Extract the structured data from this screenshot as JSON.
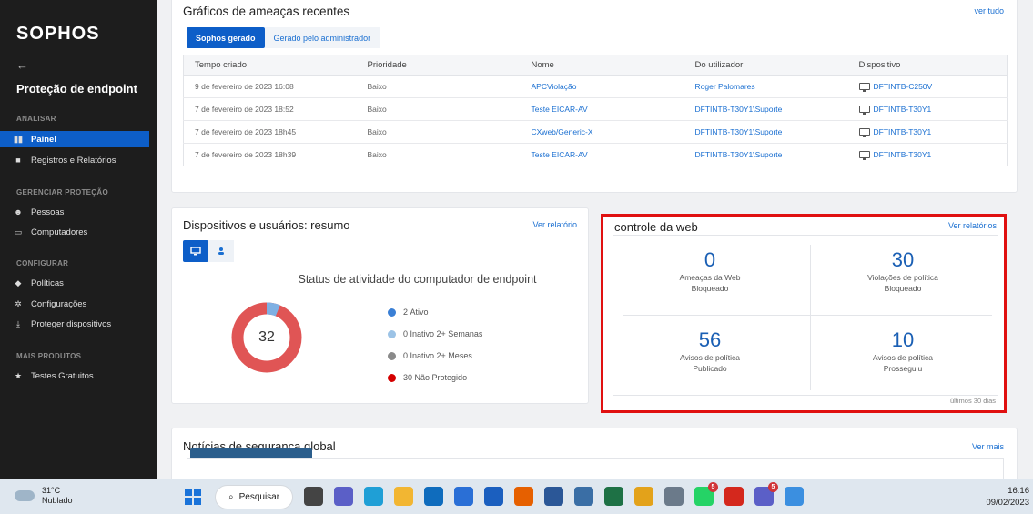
{
  "sidebar": {
    "logo": "SOPHOS",
    "back_arrow": "←",
    "section_title": "Proteção de endpoint",
    "groups": {
      "analisar": "ANALISAR",
      "gerenciar": "GERENCIAR PROTEÇÃO",
      "configurar": "CONFIGURAR",
      "mais": "MAIS PRODUTOS"
    },
    "items": [
      {
        "label": "Painel",
        "icon": "bar-chart-icon",
        "active": true
      },
      {
        "label": "Registros e Relatórios",
        "icon": "document-icon"
      },
      {
        "label": "Pessoas",
        "icon": "people-icon"
      },
      {
        "label": "Computadores",
        "icon": "monitor-icon"
      },
      {
        "label": "Políticas",
        "icon": "shield-icon"
      },
      {
        "label": "Configurações",
        "icon": "gear-icon"
      },
      {
        "label": "Proteger dispositivos",
        "icon": "download-icon"
      },
      {
        "label": "Testes Gratuitos",
        "icon": "star-icon"
      }
    ]
  },
  "threats": {
    "title": "Gráficos de ameaças recentes",
    "link": "ver tudo",
    "tabs": [
      "Sophos gerado",
      "Gerado pelo administrador"
    ],
    "columns": [
      "Tempo criado",
      "Prioridade",
      "Nome",
      "Do utilizador",
      "Dispositivo"
    ],
    "rows": [
      [
        "9 de fevereiro de 2023 16:08",
        "Baixo",
        "APCViolação",
        "Roger Palomares",
        "DFTINTB-C250V"
      ],
      [
        "7 de fevereiro de 2023 18:52",
        "Baixo",
        "Teste EICAR-AV",
        "DFTINTB-T30Y1\\Suporte",
        "DFTINTB-T30Y1"
      ],
      [
        "7 de fevereiro de 2023 18h45",
        "Baixo",
        "CXweb/Generic-X",
        "DFTINTB-T30Y1\\Suporte",
        "DFTINTB-T30Y1"
      ],
      [
        "7 de fevereiro de 2023 18h39",
        "Baixo",
        "Teste EICAR-AV",
        "DFTINTB-T30Y1\\Suporte",
        "DFTINTB-T30Y1"
      ]
    ]
  },
  "devices": {
    "title": "Dispositivos e usuários: resumo",
    "link": "Ver relatório",
    "status_title": "Status de atividade do computador de endpoint",
    "total": "32",
    "legend": [
      {
        "count": "2",
        "label": "Ativo",
        "color": "#3a7fd5"
      },
      {
        "count": "0",
        "label": "Inativo 2+ Semanas",
        "color": "#9cc3e6"
      },
      {
        "count": "0",
        "label": "Inativo 2+ Meses",
        "color": "#8a8a8a"
      },
      {
        "count": "30",
        "label": "Não Protegido",
        "color": "#d40000"
      }
    ],
    "donut": {
      "active_fraction": 0.0625,
      "active_color": "#7fb0e3",
      "unprotected_color": "#e05555"
    }
  },
  "web_control": {
    "title": "controle da web",
    "link": "Ver relatórios",
    "cells": [
      {
        "value": "0",
        "line1": "Ameaças da Web",
        "line2": "Bloqueado"
      },
      {
        "value": "30",
        "line1": "Violações de política",
        "line2": "Bloqueado"
      },
      {
        "value": "56",
        "line1": "Avisos de política",
        "line2": "Publicado"
      },
      {
        "value": "10",
        "line1": "Avisos de política",
        "line2": "Prosseguiu"
      }
    ],
    "footer": "últimos 30 dias"
  },
  "news": {
    "title": "Notícias de segurança global",
    "link": "Ver mais"
  },
  "taskbar": {
    "temp": "31°C",
    "weather": "Nublado",
    "search": "Pesquisar",
    "time": "16:16",
    "date": "09/02/2023",
    "apps": [
      {
        "name": "task-view-icon",
        "color": "#444"
      },
      {
        "name": "chat-icon",
        "color": "#5b5fc7"
      },
      {
        "name": "edge-icon",
        "color": "#1f9fd6"
      },
      {
        "name": "file-explorer-icon",
        "color": "#f2b632"
      },
      {
        "name": "outlook-icon",
        "color": "#0f6cbd"
      },
      {
        "name": "store-icon",
        "color": "#2a6fd6"
      },
      {
        "name": "mail-icon",
        "color": "#1b5fbf"
      },
      {
        "name": "firefox-icon",
        "color": "#e66000"
      },
      {
        "name": "word-icon",
        "color": "#2b5797"
      },
      {
        "name": "notepad-icon",
        "color": "#3a6ea5"
      },
      {
        "name": "excel-icon",
        "color": "#1e7145"
      },
      {
        "name": "chrome-icon",
        "color": "#e3a21a"
      },
      {
        "name": "settings-icon",
        "color": "#6b7a8a"
      },
      {
        "name": "whatsapp-icon",
        "color": "#25d366",
        "badge": "5"
      },
      {
        "name": "acrobat-icon",
        "color": "#d4281d"
      },
      {
        "name": "teams-icon",
        "color": "#5b5fc7",
        "badge": "5"
      },
      {
        "name": "photos-icon",
        "color": "#3b8fe0"
      }
    ]
  }
}
